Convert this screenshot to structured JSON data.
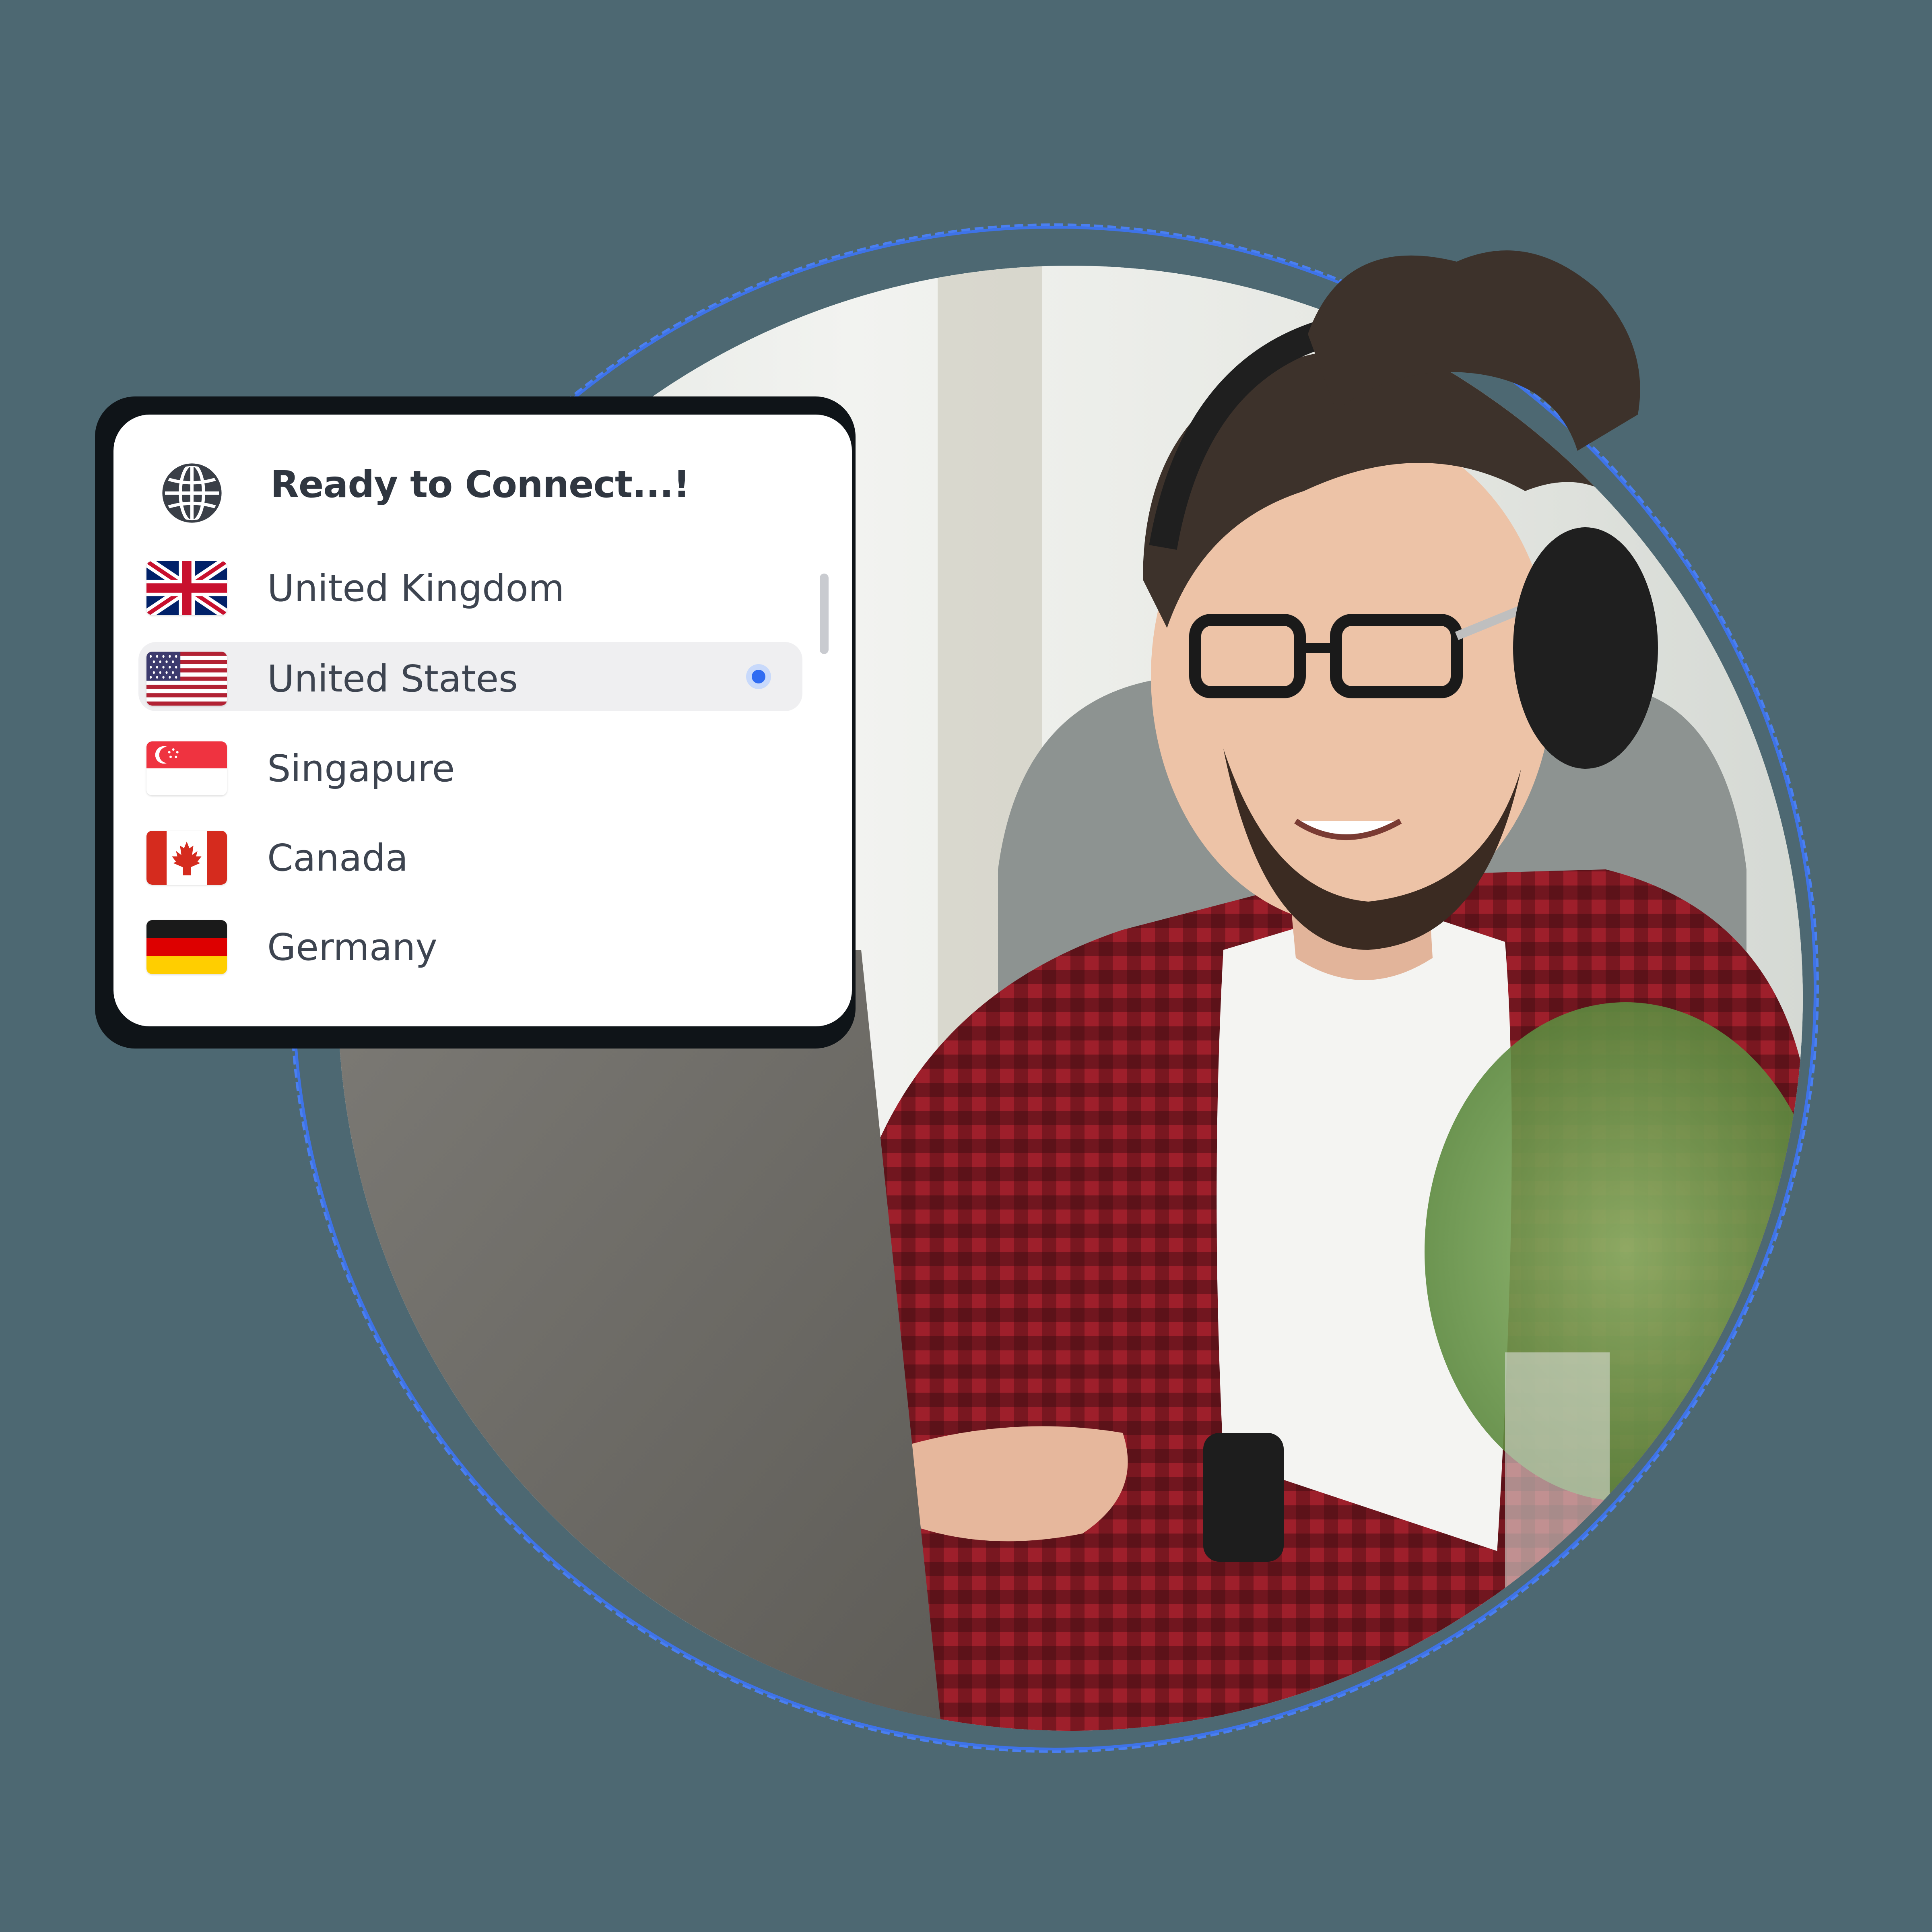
{
  "card": {
    "icon": "globe-icon",
    "title": "Ready to Connect...!"
  },
  "countries": [
    {
      "name": "United Kingdom",
      "flag": "uk-flag-icon",
      "selected": false
    },
    {
      "name": "United States",
      "flag": "us-flag-icon",
      "selected": true
    },
    {
      "name": "Singapure",
      "flag": "singapore-flag-icon",
      "selected": false
    },
    {
      "name": "Canada",
      "flag": "canada-flag-icon",
      "selected": false
    },
    {
      "name": "Germany",
      "flag": "germany-flag-icon",
      "selected": false
    }
  ],
  "colors": {
    "background": "#4d6872",
    "ring": "#3e73e8",
    "accent": "#2f6bf2",
    "text": "#3d4450"
  }
}
